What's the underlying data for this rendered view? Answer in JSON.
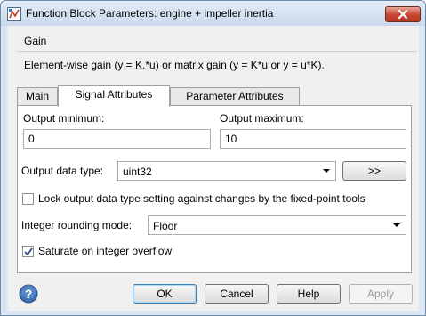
{
  "window": {
    "title": "Function Block Parameters: engine + impeller inertia"
  },
  "block": {
    "name": "Gain",
    "description": "Element-wise gain (y = K.*u) or matrix gain (y = K*u or y = u*K)."
  },
  "tabs": [
    {
      "label": "Main",
      "active": false
    },
    {
      "label": "Signal Attributes",
      "active": true
    },
    {
      "label": "Parameter Attributes",
      "active": false
    }
  ],
  "signal_attributes": {
    "output_minimum_label": "Output minimum:",
    "output_minimum_value": "0",
    "output_maximum_label": "Output maximum:",
    "output_maximum_value": "10",
    "output_data_type_label": "Output data type:",
    "output_data_type_value": "uint32",
    "data_type_assistant_label": ">>",
    "lock_label": "Lock output data type setting against changes by the fixed-point tools",
    "lock_checked": false,
    "rounding_label": "Integer rounding mode:",
    "rounding_value": "Floor",
    "saturate_label": "Saturate on integer overflow",
    "saturate_checked": true
  },
  "buttons": {
    "ok": "OK",
    "cancel": "Cancel",
    "help": "Help",
    "apply": "Apply"
  },
  "icons": {
    "app": "simulink-block-icon",
    "help": "help-icon",
    "close": "close-icon"
  }
}
